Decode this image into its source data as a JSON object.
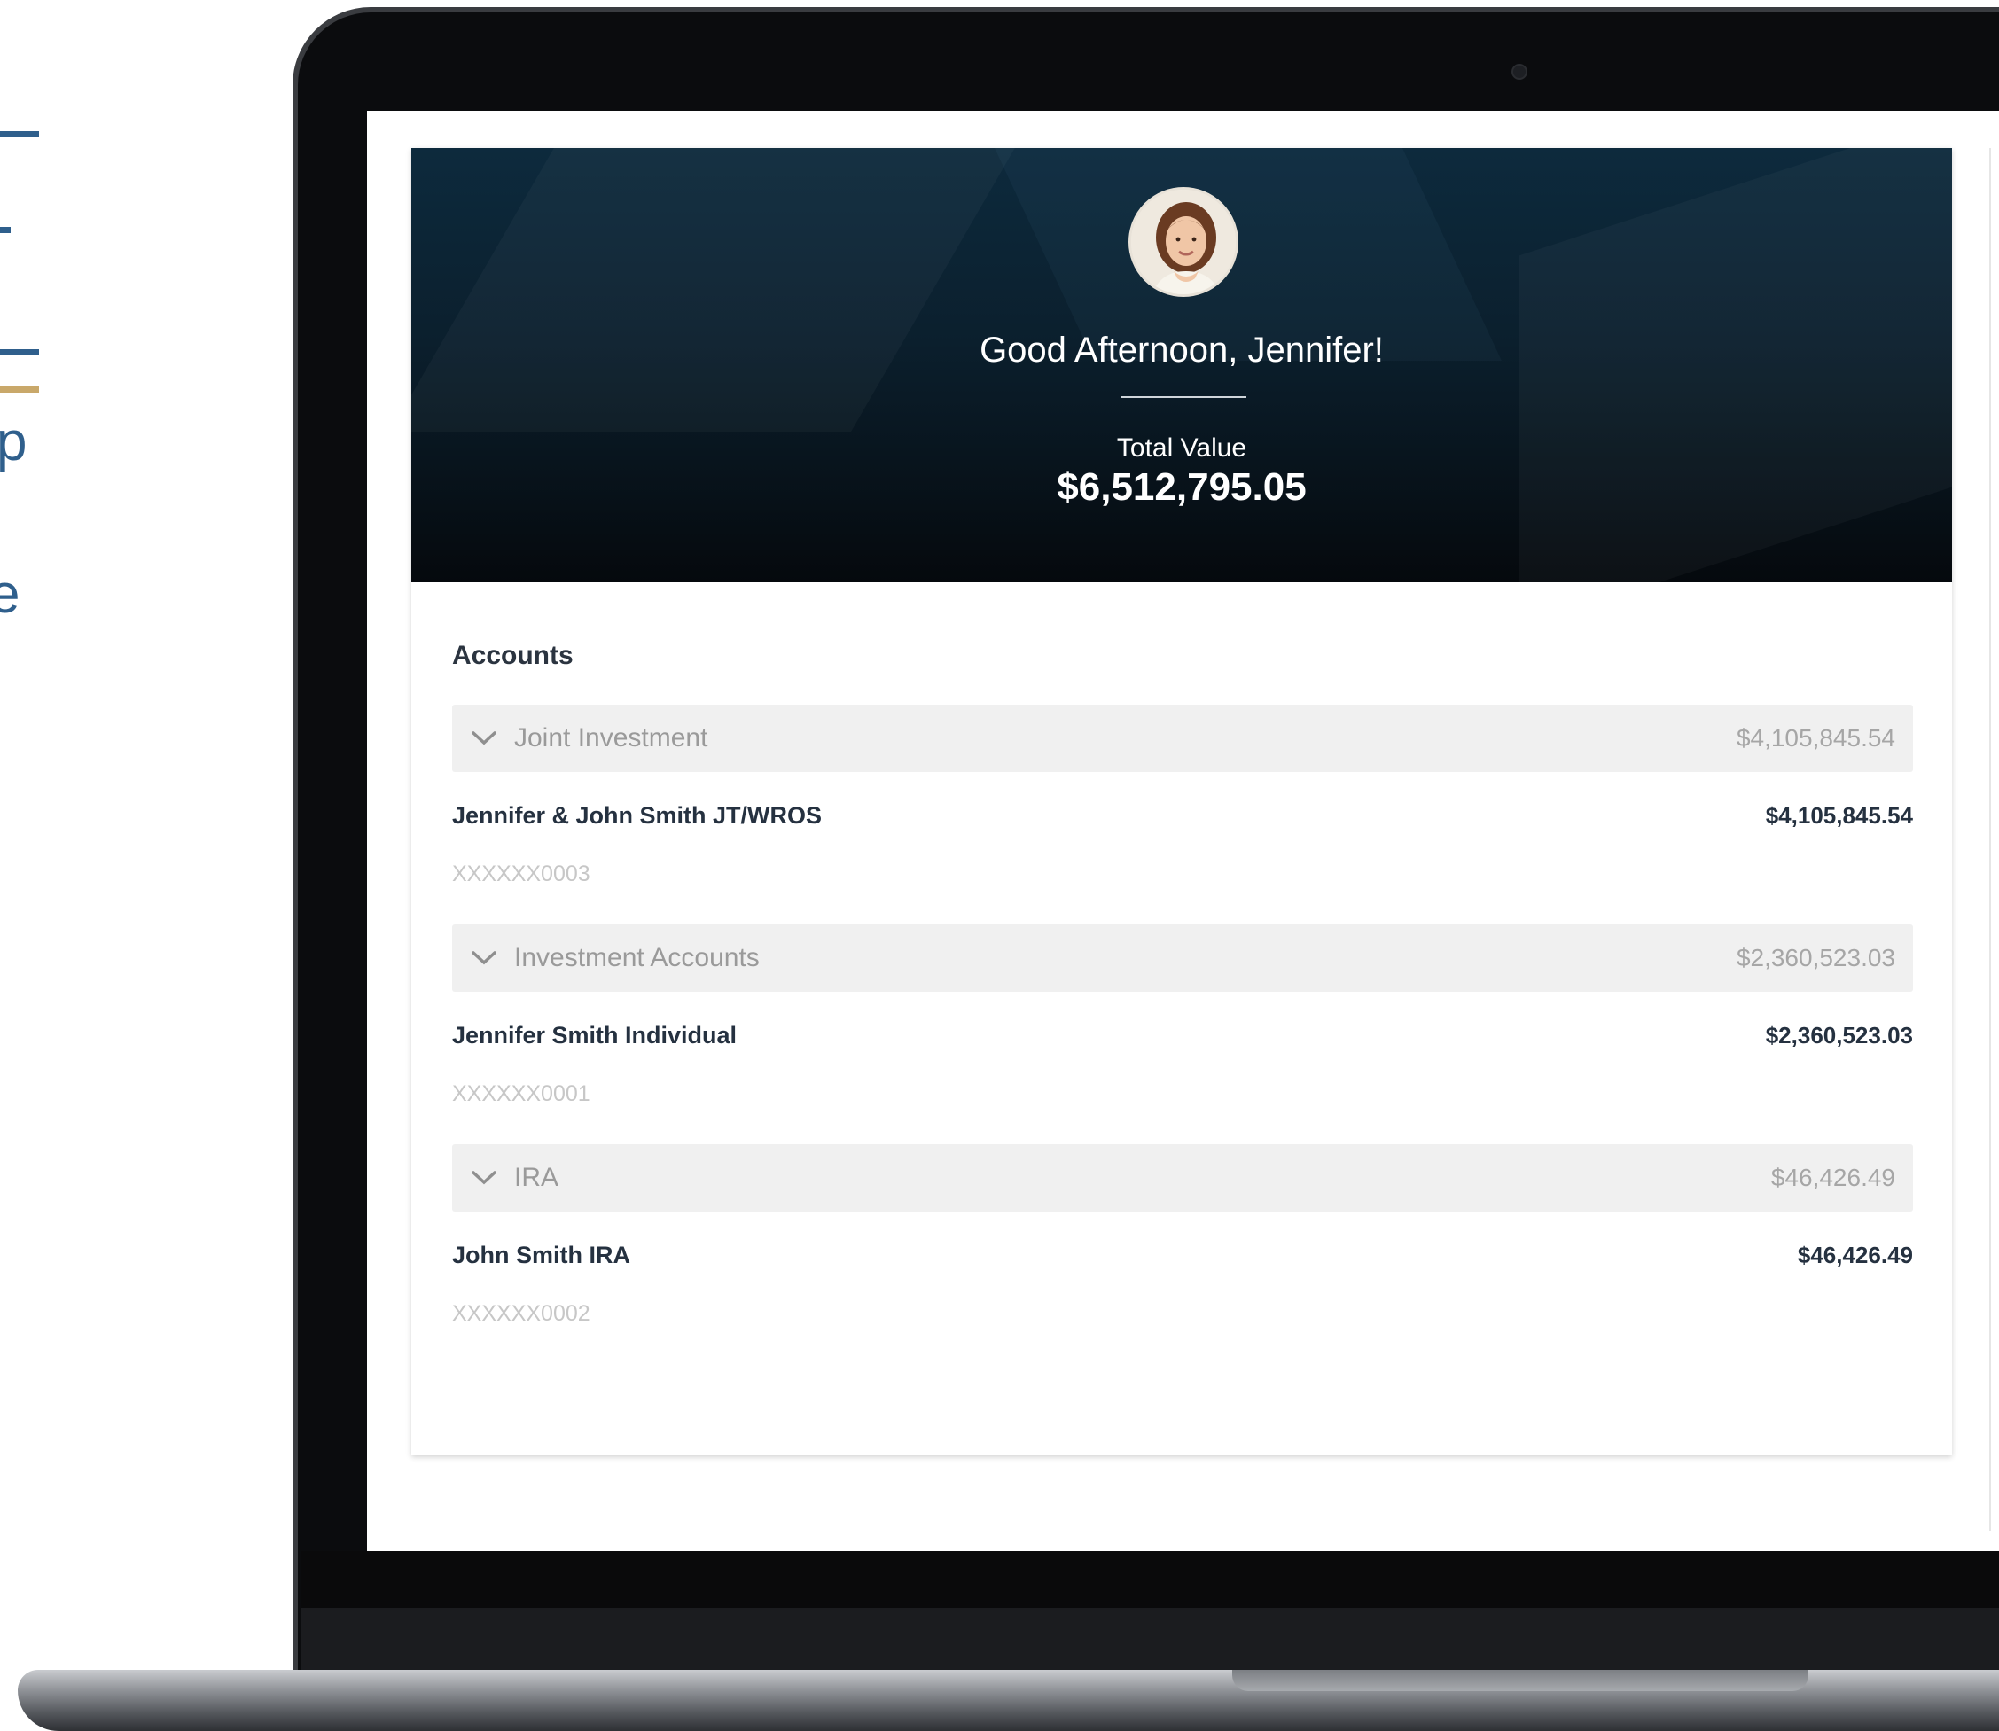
{
  "brand": {
    "text_fragment_1": "p",
    "text_fragment_2": "e",
    "colors": {
      "primary": "#2f5f8c",
      "accent": "#c9a86a"
    }
  },
  "hero": {
    "avatar": "user-avatar-photo",
    "greeting": "Good Afternoon, Jennifer!",
    "total_label": "Total Value",
    "total_value": "$6,512,795.05"
  },
  "accounts": {
    "title": "Accounts",
    "groups": [
      {
        "name": "Joint Investment",
        "total": "$4,105,845.54",
        "icon": "chevron-down-icon",
        "account": {
          "name": "Jennifer & John Smith JT/WROS",
          "value": "$4,105,845.54",
          "number": "XXXXXX0003"
        }
      },
      {
        "name": "Investment Accounts",
        "total": "$2,360,523.03",
        "icon": "chevron-down-icon",
        "account": {
          "name": "Jennifer Smith Individual",
          "value": "$2,360,523.03",
          "number": "XXXXXX0001"
        }
      },
      {
        "name": "IRA",
        "total": "$46,426.49",
        "icon": "chevron-down-icon",
        "account": {
          "name": "John Smith IRA",
          "value": "$46,426.49",
          "number": "XXXXXX0002"
        }
      }
    ]
  }
}
